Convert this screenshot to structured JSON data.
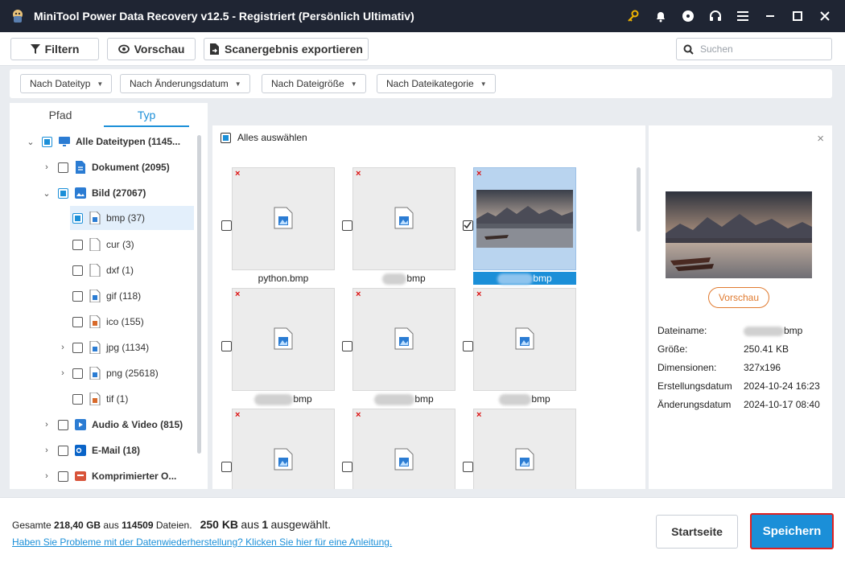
{
  "titlebar": {
    "title": "MiniTool Power Data Recovery v12.5 - Registriert (Persönlich Ultimativ)"
  },
  "toolbar": {
    "filter_label": "Filtern",
    "preview_label": "Vorschau",
    "export_label": "Scanergebnis exportieren",
    "search_placeholder": "Suchen"
  },
  "filters": [
    "Nach Dateityp",
    "Nach Änderungsdatum",
    "Nach Dateigröße",
    "Nach Dateikategorie"
  ],
  "tabs": [
    "Pfad",
    "Typ"
  ],
  "tree": [
    {
      "label": "Alle Dateitypen (1145...",
      "icon": "monitor-icon"
    },
    {
      "label": "Dokument (2095)",
      "icon": "document-icon"
    },
    {
      "label": "Bild (27067)",
      "icon": "image-icon"
    },
    {
      "label": "bmp (37)",
      "icon": "bmp-file-icon"
    },
    {
      "label": "cur (3)",
      "icon": "file-icon"
    },
    {
      "label": "dxf (1)",
      "icon": "file-icon"
    },
    {
      "label": "gif (118)",
      "icon": "gif-file-icon"
    },
    {
      "label": "ico (155)",
      "icon": "ico-file-icon"
    },
    {
      "label": "jpg (1134)",
      "icon": "jpg-file-icon"
    },
    {
      "label": "png (25618)",
      "icon": "png-file-icon"
    },
    {
      "label": "tif (1)",
      "icon": "tif-file-icon"
    },
    {
      "label": "Audio & Video (815)",
      "icon": "video-icon"
    },
    {
      "label": "E-Mail (18)",
      "icon": "outlook-icon"
    },
    {
      "label": "Komprimierter O...",
      "icon": "archive-icon"
    }
  ],
  "grid": {
    "select_all_label": "Alles auswählen",
    "tiles": [
      {
        "label": "python.bmp"
      },
      {
        "label": "bmp"
      },
      {
        "label": "bmp"
      },
      {
        "label": "bmp"
      },
      {
        "label": "bmp"
      },
      {
        "label": "bmp"
      }
    ]
  },
  "preview": {
    "button_label": "Vorschau",
    "fields": [
      {
        "key": "Dateiname:",
        "value": "bmp"
      },
      {
        "key": "Größe:",
        "value": "250.41 KB"
      },
      {
        "key": "Dimensionen:",
        "value": "327x196"
      },
      {
        "key": "Erstellungsdatum",
        "value": "2024-10-24 16:23"
      },
      {
        "key": "Änderungsdatum",
        "value": "2024-10-17 08:40"
      }
    ]
  },
  "footer": {
    "total_prefix": "Gesamte",
    "total_size": "218,40 GB",
    "total_mid": "aus",
    "total_files": "114509",
    "total_suffix": "Dateien.",
    "selected_size": "250 KB",
    "selected_mid": "aus",
    "selected_count": "1",
    "selected_suffix": "ausgewählt.",
    "help_link": "Haben Sie Probleme mit der Datenwiederherstellung? Klicken Sie hier für eine Anleitung.",
    "home_label": "Startseite",
    "save_label": "Speichern"
  },
  "colors": {
    "accent": "#1b8fd8",
    "titlebar": "#1f2533",
    "preview_button": "#e07a2f",
    "save_border": "#e02020"
  }
}
